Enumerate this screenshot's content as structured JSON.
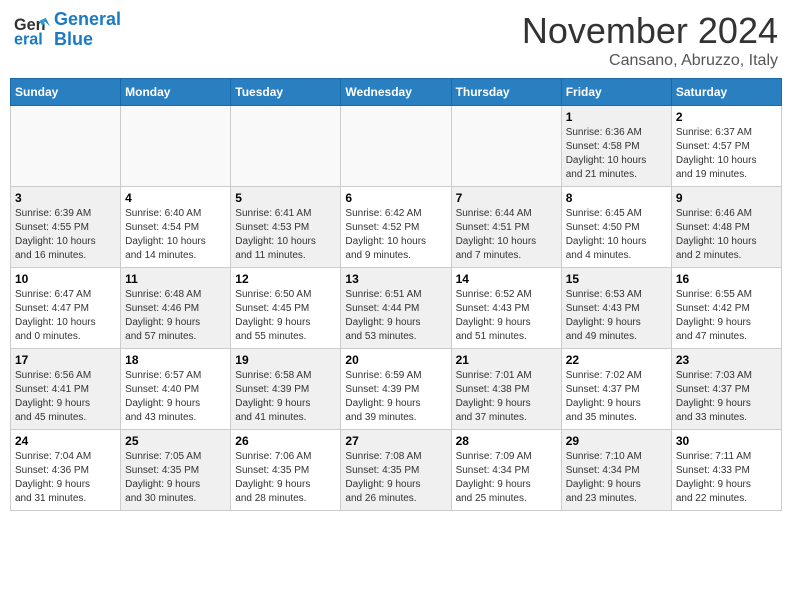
{
  "header": {
    "logo_line1": "General",
    "logo_line2": "Blue",
    "month": "November 2024",
    "location": "Cansano, Abruzzo, Italy"
  },
  "weekdays": [
    "Sunday",
    "Monday",
    "Tuesday",
    "Wednesday",
    "Thursday",
    "Friday",
    "Saturday"
  ],
  "weeks": [
    [
      {
        "day": "",
        "info": "",
        "empty": true
      },
      {
        "day": "",
        "info": "",
        "empty": true
      },
      {
        "day": "",
        "info": "",
        "empty": true
      },
      {
        "day": "",
        "info": "",
        "empty": true
      },
      {
        "day": "",
        "info": "",
        "empty": true
      },
      {
        "day": "1",
        "info": "Sunrise: 6:36 AM\nSunset: 4:58 PM\nDaylight: 10 hours\nand 21 minutes.",
        "shaded": true
      },
      {
        "day": "2",
        "info": "Sunrise: 6:37 AM\nSunset: 4:57 PM\nDaylight: 10 hours\nand 19 minutes.",
        "shaded": false
      }
    ],
    [
      {
        "day": "3",
        "info": "Sunrise: 6:39 AM\nSunset: 4:55 PM\nDaylight: 10 hours\nand 16 minutes.",
        "shaded": true
      },
      {
        "day": "4",
        "info": "Sunrise: 6:40 AM\nSunset: 4:54 PM\nDaylight: 10 hours\nand 14 minutes.",
        "shaded": false
      },
      {
        "day": "5",
        "info": "Sunrise: 6:41 AM\nSunset: 4:53 PM\nDaylight: 10 hours\nand 11 minutes.",
        "shaded": true
      },
      {
        "day": "6",
        "info": "Sunrise: 6:42 AM\nSunset: 4:52 PM\nDaylight: 10 hours\nand 9 minutes.",
        "shaded": false
      },
      {
        "day": "7",
        "info": "Sunrise: 6:44 AM\nSunset: 4:51 PM\nDaylight: 10 hours\nand 7 minutes.",
        "shaded": true
      },
      {
        "day": "8",
        "info": "Sunrise: 6:45 AM\nSunset: 4:50 PM\nDaylight: 10 hours\nand 4 minutes.",
        "shaded": false
      },
      {
        "day": "9",
        "info": "Sunrise: 6:46 AM\nSunset: 4:48 PM\nDaylight: 10 hours\nand 2 minutes.",
        "shaded": true
      }
    ],
    [
      {
        "day": "10",
        "info": "Sunrise: 6:47 AM\nSunset: 4:47 PM\nDaylight: 10 hours\nand 0 minutes.",
        "shaded": false
      },
      {
        "day": "11",
        "info": "Sunrise: 6:48 AM\nSunset: 4:46 PM\nDaylight: 9 hours\nand 57 minutes.",
        "shaded": true
      },
      {
        "day": "12",
        "info": "Sunrise: 6:50 AM\nSunset: 4:45 PM\nDaylight: 9 hours\nand 55 minutes.",
        "shaded": false
      },
      {
        "day": "13",
        "info": "Sunrise: 6:51 AM\nSunset: 4:44 PM\nDaylight: 9 hours\nand 53 minutes.",
        "shaded": true
      },
      {
        "day": "14",
        "info": "Sunrise: 6:52 AM\nSunset: 4:43 PM\nDaylight: 9 hours\nand 51 minutes.",
        "shaded": false
      },
      {
        "day": "15",
        "info": "Sunrise: 6:53 AM\nSunset: 4:43 PM\nDaylight: 9 hours\nand 49 minutes.",
        "shaded": true
      },
      {
        "day": "16",
        "info": "Sunrise: 6:55 AM\nSunset: 4:42 PM\nDaylight: 9 hours\nand 47 minutes.",
        "shaded": false
      }
    ],
    [
      {
        "day": "17",
        "info": "Sunrise: 6:56 AM\nSunset: 4:41 PM\nDaylight: 9 hours\nand 45 minutes.",
        "shaded": true
      },
      {
        "day": "18",
        "info": "Sunrise: 6:57 AM\nSunset: 4:40 PM\nDaylight: 9 hours\nand 43 minutes.",
        "shaded": false
      },
      {
        "day": "19",
        "info": "Sunrise: 6:58 AM\nSunset: 4:39 PM\nDaylight: 9 hours\nand 41 minutes.",
        "shaded": true
      },
      {
        "day": "20",
        "info": "Sunrise: 6:59 AM\nSunset: 4:39 PM\nDaylight: 9 hours\nand 39 minutes.",
        "shaded": false
      },
      {
        "day": "21",
        "info": "Sunrise: 7:01 AM\nSunset: 4:38 PM\nDaylight: 9 hours\nand 37 minutes.",
        "shaded": true
      },
      {
        "day": "22",
        "info": "Sunrise: 7:02 AM\nSunset: 4:37 PM\nDaylight: 9 hours\nand 35 minutes.",
        "shaded": false
      },
      {
        "day": "23",
        "info": "Sunrise: 7:03 AM\nSunset: 4:37 PM\nDaylight: 9 hours\nand 33 minutes.",
        "shaded": true
      }
    ],
    [
      {
        "day": "24",
        "info": "Sunrise: 7:04 AM\nSunset: 4:36 PM\nDaylight: 9 hours\nand 31 minutes.",
        "shaded": false
      },
      {
        "day": "25",
        "info": "Sunrise: 7:05 AM\nSunset: 4:35 PM\nDaylight: 9 hours\nand 30 minutes.",
        "shaded": true
      },
      {
        "day": "26",
        "info": "Sunrise: 7:06 AM\nSunset: 4:35 PM\nDaylight: 9 hours\nand 28 minutes.",
        "shaded": false
      },
      {
        "day": "27",
        "info": "Sunrise: 7:08 AM\nSunset: 4:35 PM\nDaylight: 9 hours\nand 26 minutes.",
        "shaded": true
      },
      {
        "day": "28",
        "info": "Sunrise: 7:09 AM\nSunset: 4:34 PM\nDaylight: 9 hours\nand 25 minutes.",
        "shaded": false
      },
      {
        "day": "29",
        "info": "Sunrise: 7:10 AM\nSunset: 4:34 PM\nDaylight: 9 hours\nand 23 minutes.",
        "shaded": true
      },
      {
        "day": "30",
        "info": "Sunrise: 7:11 AM\nSunset: 4:33 PM\nDaylight: 9 hours\nand 22 minutes.",
        "shaded": false
      }
    ]
  ]
}
